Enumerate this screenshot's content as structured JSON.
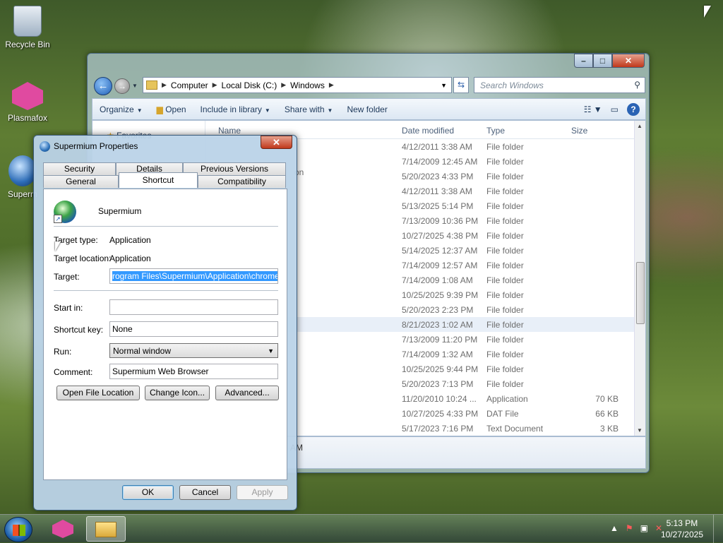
{
  "desktop": {
    "icons": [
      {
        "label": "Recycle Bin"
      },
      {
        "label": "Plasmafox"
      },
      {
        "label": "Superm"
      }
    ]
  },
  "explorer": {
    "address": {
      "crumbs": [
        "Computer",
        "Local Disk (C:)",
        "Windows"
      ]
    },
    "search_placeholder": "Search Windows",
    "toolbar": {
      "organize": "Organize",
      "open": "Open",
      "include": "Include in library",
      "share": "Share with",
      "new_folder": "New folder"
    },
    "nav": {
      "favorites": "Favorites"
    },
    "columns": {
      "name": "Name",
      "date": "Date modified",
      "type": "Type",
      "size": "Size"
    },
    "rows": [
      {
        "date": "4/12/2011 3:38 AM",
        "type": "File folder",
        "size": ""
      },
      {
        "date": "7/14/2009 12:45 AM",
        "type": "File folder",
        "size": ""
      },
      {
        "date": "5/20/2023 4:33 PM",
        "type": "File folder",
        "size": ""
      },
      {
        "date": "4/12/2011 3:38 AM",
        "type": "File folder",
        "size": ""
      },
      {
        "date": "5/13/2025 5:14 PM",
        "type": "File folder",
        "size": ""
      },
      {
        "date": "7/13/2009 10:36 PM",
        "type": "File folder",
        "size": ""
      },
      {
        "date": "10/27/2025 4:38 PM",
        "type": "File folder",
        "size": ""
      },
      {
        "date": "5/14/2025 12:37 AM",
        "type": "File folder",
        "size": ""
      },
      {
        "date": "7/14/2009 12:57 AM",
        "type": "File folder",
        "size": ""
      },
      {
        "date": "7/14/2009 1:08 AM",
        "type": "File folder",
        "size": ""
      },
      {
        "date": "10/25/2025 9:39 PM",
        "type": "File folder",
        "size": ""
      },
      {
        "date": "5/20/2023 2:23 PM",
        "type": "File folder",
        "size": ""
      },
      {
        "date": "8/21/2023 1:02 AM",
        "type": "File folder",
        "size": ""
      },
      {
        "date": "7/13/2009 11:20 PM",
        "type": "File folder",
        "size": ""
      },
      {
        "date": "7/14/2009 1:32 AM",
        "type": "File folder",
        "size": ""
      },
      {
        "date": "10/25/2025 9:44 PM",
        "type": "File folder",
        "size": ""
      },
      {
        "date": "5/20/2023 7:13 PM",
        "type": "File folder",
        "size": ""
      },
      {
        "date": "11/20/2010 10:24 ...",
        "type": "Application",
        "size": "70 KB"
      },
      {
        "date": "10/27/2025 4:33 PM",
        "type": "DAT File",
        "size": "66 KB"
      },
      {
        "date": "5/17/2023 7:16 PM",
        "type": "Text Document",
        "size": "3 KB"
      }
    ],
    "partial_name_text": "on",
    "details_text": "AM"
  },
  "dialog": {
    "title": "Supermium Properties",
    "tabs_row1": [
      "Security",
      "Details",
      "Previous Versions"
    ],
    "tabs_row2": [
      "General",
      "Shortcut",
      "Compatibility"
    ],
    "app_name": "Supermium",
    "target_type_label": "Target type:",
    "target_type_value": "Application",
    "target_location_label": "Target location:",
    "target_location_value": "Application",
    "target_label": "Target:",
    "target_value": "rogram Files\\Supermium\\Application\\chrome.exe\"",
    "start_in_label": "Start in:",
    "start_in_value": "",
    "shortcut_key_label": "Shortcut key:",
    "shortcut_key_value": "None",
    "run_label": "Run:",
    "run_value": "Normal window",
    "comment_label": "Comment:",
    "comment_value": "Supermium Web Browser",
    "open_file_location": "Open File Location",
    "change_icon": "Change Icon...",
    "advanced": "Advanced...",
    "ok": "OK",
    "cancel": "Cancel",
    "apply": "Apply"
  },
  "taskbar": {
    "time": "5:13 PM",
    "date": "10/27/2025"
  }
}
